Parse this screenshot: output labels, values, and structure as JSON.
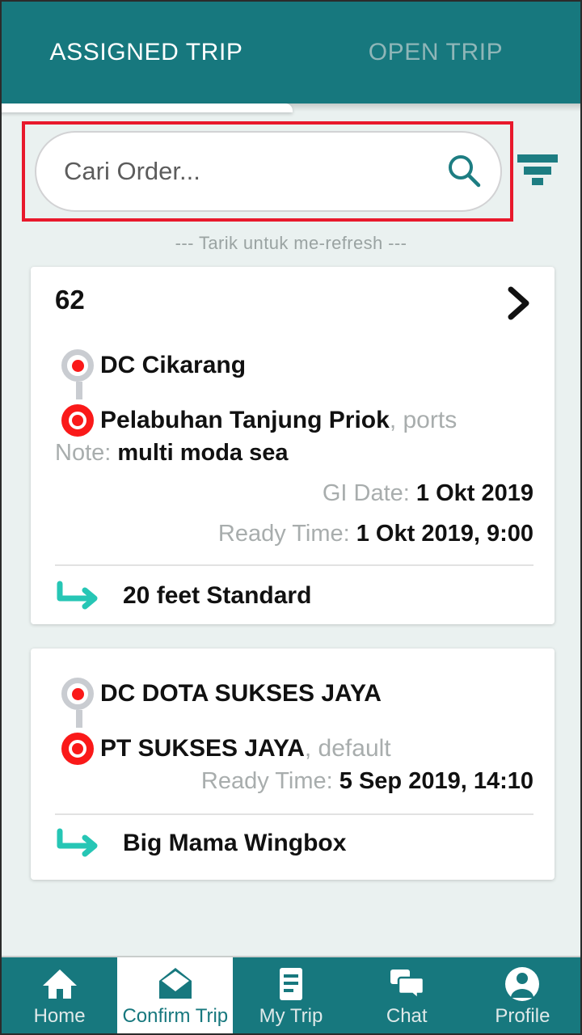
{
  "theme": {
    "primary": "#17787e",
    "page_bg": "#eaf1f0",
    "accent_teal": "#26c6b5",
    "marker_red": "#fa1919",
    "annotation_red": "#e8192c"
  },
  "tabs": [
    {
      "label": "ASSIGNED TRIP",
      "active": true
    },
    {
      "label": "OPEN TRIP",
      "active": false
    }
  ],
  "search": {
    "value": "",
    "placeholder": "Cari Order...",
    "search_icon": "search-icon",
    "filter_icon": "filter-icon"
  },
  "refresh_hint": "--- Tarik untuk me-refresh ---",
  "cards": [
    {
      "trip_id": "62",
      "chevron_icon": "chevron-right-icon",
      "origin": {
        "name": "DC Cikarang",
        "type": ""
      },
      "destination": {
        "name": "Pelabuhan Tanjung Priok",
        "type": ", ports"
      },
      "note_label": "Note: ",
      "note_value": "multi moda sea",
      "meta": [
        {
          "label": "GI Date: ",
          "value": "1 Okt 2019"
        },
        {
          "label": "Ready Time: ",
          "value": "1 Okt 2019, 9:00"
        }
      ],
      "vehicle": "20 feet Standard",
      "vehicle_icon": "turn-arrow-icon"
    },
    {
      "trip_id": "",
      "chevron_icon": "",
      "origin": {
        "name": "DC DOTA SUKSES JAYA",
        "type": ""
      },
      "destination": {
        "name": "PT SUKSES JAYA",
        "type": ", default"
      },
      "note_label": "",
      "note_value": "",
      "meta": [
        {
          "label": "Ready Time: ",
          "value": "5 Sep 2019, 14:10"
        }
      ],
      "vehicle": "Big Mama Wingbox",
      "vehicle_icon": "turn-arrow-icon"
    }
  ],
  "bottom_nav": [
    {
      "label": "Home",
      "icon": "home-icon",
      "active": false
    },
    {
      "label": "Confirm Trip",
      "icon": "envelope-icon",
      "active": true
    },
    {
      "label": "My Trip",
      "icon": "list-icon",
      "active": false
    },
    {
      "label": "Chat",
      "icon": "chat-icon",
      "active": false
    },
    {
      "label": "Profile",
      "icon": "person-icon",
      "active": false
    }
  ]
}
